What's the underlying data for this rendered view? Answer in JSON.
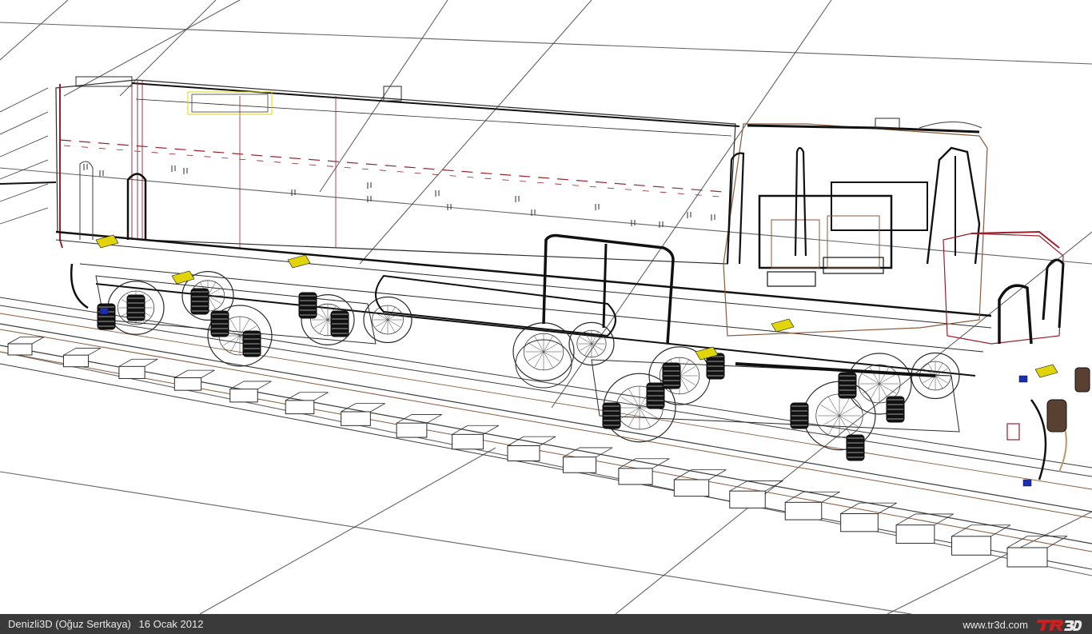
{
  "viewport": {
    "subject": "wireframe-locomotive-render",
    "colors": {
      "background": "#ffffff",
      "grid": "#3c3c3c",
      "wire": "#2a2a2a",
      "heavy": "#111111",
      "red": "#9a1f2b",
      "brown": "#8a5a3a",
      "yellow": "#e2d40a",
      "blue": "#1a2fb0",
      "tan": "#b89a6a"
    }
  },
  "caption": {
    "author": "Denizli3D (Oğuz Sertkaya)",
    "date": "16 Ocak 2012",
    "site": "www.tr3d.com",
    "logo_text": "TR3D",
    "bar_color": "#3a3a3a",
    "logo_colors": {
      "tr": "#cc2020",
      "three_d": "#e8e8e8"
    }
  }
}
